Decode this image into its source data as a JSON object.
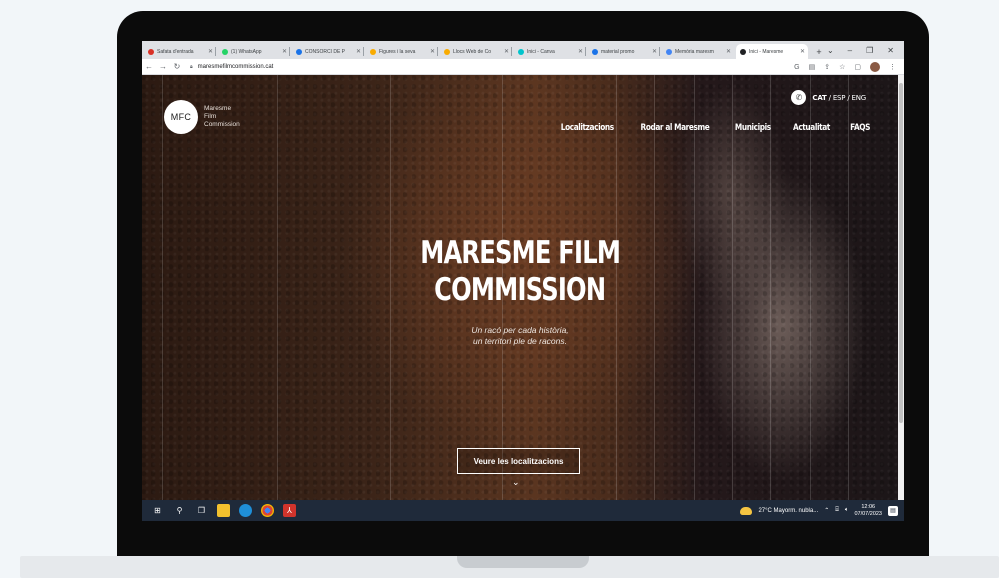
{
  "browser": {
    "tabs": [
      {
        "label": "Safata d'entrada",
        "color": "#d93025"
      },
      {
        "label": "(1) WhatsApp",
        "color": "#25d366"
      },
      {
        "label": "CONSORCI DE P",
        "color": "#1a73e8"
      },
      {
        "label": "Figures i la seva",
        "color": "#f9ab00"
      },
      {
        "label": "Llocs Web de Co",
        "color": "#f9ab00"
      },
      {
        "label": "Inici - Canva",
        "color": "#00c4cc"
      },
      {
        "label": "material promo",
        "color": "#1a73e8"
      },
      {
        "label": "Memòria maresm",
        "color": "#4285f4"
      },
      {
        "label": "Inici - Maresme",
        "color": "#202124"
      }
    ],
    "new_tab": "+",
    "url": "maresmefilmcommission.cat"
  },
  "site": {
    "logo_mark": "MFC",
    "logo_lines": [
      "Maresme",
      "Film",
      "Commission"
    ],
    "lang": {
      "active": "CAT",
      "others": " / ESP / ENG"
    },
    "menu": [
      "Localitzacions",
      "Rodar al Maresme",
      "Municipis",
      "Actualitat",
      "FAQS"
    ],
    "hero_title_1": "MARESME FILM",
    "hero_title_2": "COMMISSION",
    "hero_sub_1": "Un racó per cada història,",
    "hero_sub_2": "un territori ple de racons.",
    "cta": "Veure les localitzacions"
  },
  "taskbar": {
    "weather": "27°C  Mayorm. nubla...",
    "time": "12:06",
    "date": "07/07/2023"
  },
  "icons": {
    "windows": "windows-icon",
    "search": "search-icon",
    "taskview": "task-view-icon",
    "explorer": "file-explorer-icon",
    "edge": "edge-icon",
    "chrome": "chrome-icon",
    "acrobat": "acrobat-icon"
  }
}
